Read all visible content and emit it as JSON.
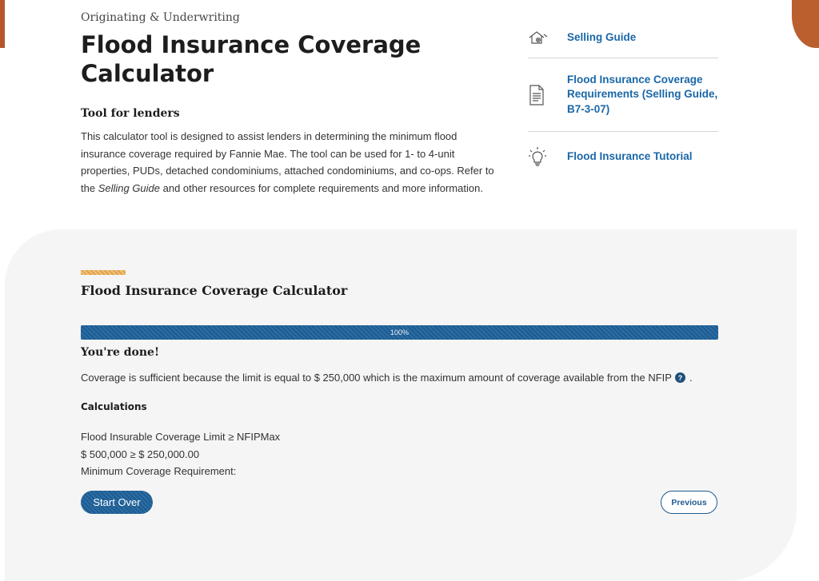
{
  "header": {
    "eyebrow": "Originating & Underwriting",
    "title": "Flood Insurance Coverage Calculator",
    "subtitle": "Tool for lenders",
    "intro_before": "This calculator tool is designed to assist lenders in determining the minimum flood insurance coverage required by Fannie Mae. The tool can be used for 1- to 4-unit properties, PUDs, detached condominiums, attached condominiums, and co-ops. Refer to the ",
    "intro_emphasis": "Selling Guide",
    "intro_after": " and other resources for complete requirements and more information."
  },
  "resources": [
    {
      "label": "Selling Guide",
      "icon": "house-icon"
    },
    {
      "label": "Flood Insurance Coverage Requirements (Selling Guide, B7-3-07)",
      "icon": "document-icon"
    },
    {
      "label": "Flood Insurance Tutorial",
      "icon": "lightbulb-icon"
    }
  ],
  "calculator": {
    "title": "Flood Insurance Coverage Calculator",
    "progress": {
      "value_percent": 100,
      "label": "100%"
    },
    "done_heading": "You're done!",
    "coverage_text": "Coverage is sufficient because the limit is equal to $ 250,000 which is the maximum amount of coverage available from the NFIP",
    "coverage_end": ".",
    "calculations_heading": "Calculations",
    "lines": [
      "Flood Insurable Coverage Limit ≥ NFIPMax",
      "$ 500,000 ≥ $ 250,000.00",
      "Minimum Coverage Requirement:"
    ],
    "start_over_label": "Start Over",
    "previous_label": "Previous"
  },
  "colors": {
    "link": "#1a67a7",
    "primary": "#1f5b8e",
    "accent": "#e0a24c",
    "panel_bg": "#f5f5f5"
  }
}
